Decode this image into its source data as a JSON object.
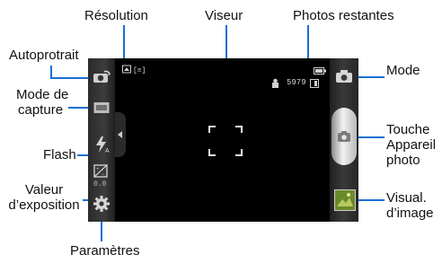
{
  "labels": {
    "resolution": "Résolution",
    "viewfinder": "Viseur",
    "remaining_photos": "Photos restantes",
    "self_portrait": "Autoprotrait",
    "capture_mode_line1": "Mode de",
    "capture_mode_line2": "capture",
    "flash": "Flash",
    "exposure_line1": "Valeur",
    "exposure_line2": "d’exposition",
    "settings": "Paramètres",
    "mode": "Mode",
    "shutter_line1": "Touche",
    "shutter_line2": "Appareil",
    "shutter_line3": "photo",
    "image_viewer_line1": "Visual.",
    "image_viewer_line2": "d’image"
  },
  "screen": {
    "remaining_count": "5979",
    "exposure_value": "0.0"
  },
  "icons": {
    "self_portrait": "self-portrait-icon",
    "capture_mode": "capture-mode-icon",
    "flash": "flash-auto-icon",
    "exposure": "exposure-icon",
    "settings": "gear-icon",
    "mode": "camera-mode-icon",
    "shutter": "shutter-camera-icon",
    "image_viewer": "image-viewer-thumbnail",
    "resolution": "resolution-icon",
    "storage": "storage-icon",
    "battery": "battery-icon"
  },
  "colors": {
    "callout_line": "#1a6fd4",
    "screen_bg": "#000000",
    "thumbnail": "#6a8a2a"
  }
}
